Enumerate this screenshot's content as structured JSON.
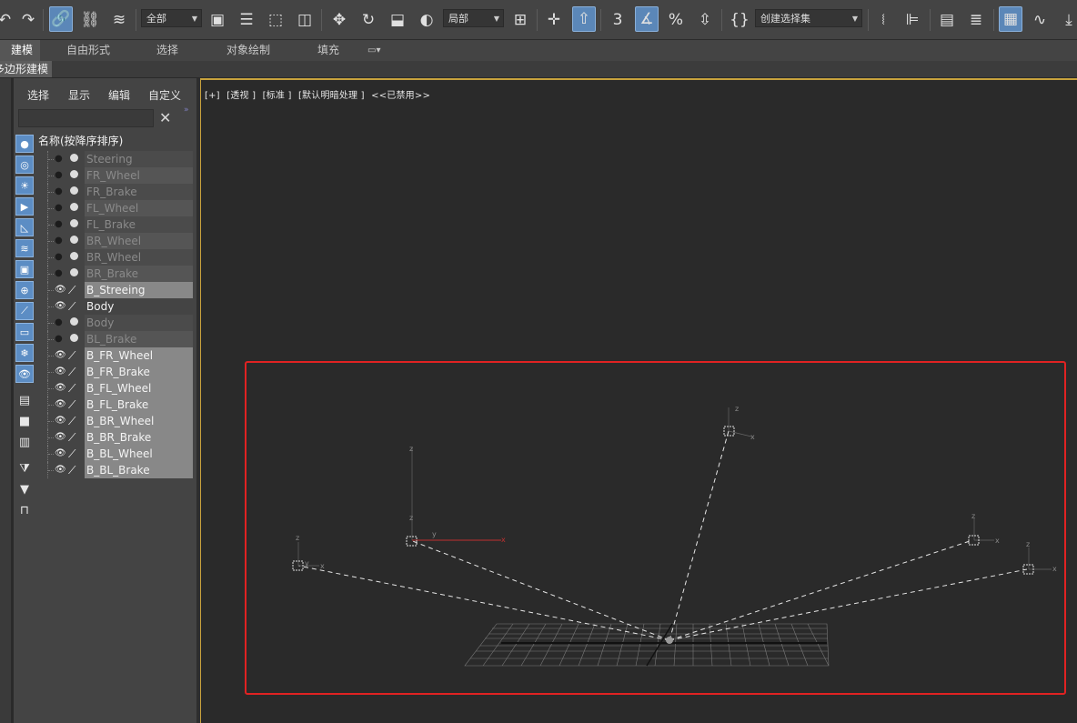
{
  "toolbar": {
    "selection_filter": "全部",
    "coord_system": "局部",
    "named_selection": "创建选择集"
  },
  "ribbon": {
    "tabs": [
      "建模",
      "自由形式",
      "选择",
      "对象绘制",
      "填充"
    ]
  },
  "subtab": {
    "label": "多边形建模"
  },
  "explorer": {
    "menu": [
      "选择",
      "显示",
      "编辑",
      "自定义"
    ],
    "search_placeholder": "",
    "column_header": "名称(按降序排序)",
    "rows": [
      {
        "name": "Steering",
        "state": "frozen"
      },
      {
        "name": "FR_Wheel",
        "state": "frozen"
      },
      {
        "name": "FR_Brake",
        "state": "frozen"
      },
      {
        "name": "FL_Wheel",
        "state": "frozen"
      },
      {
        "name": "FL_Brake",
        "state": "frozen"
      },
      {
        "name": "BR_Wheel",
        "state": "frozen"
      },
      {
        "name": "BR_Wheel",
        "state": "frozen"
      },
      {
        "name": "BR_Brake",
        "state": "frozen"
      },
      {
        "name": "B_Streeing",
        "state": "selected"
      },
      {
        "name": "Body",
        "state": "normal"
      },
      {
        "name": "Body",
        "state": "frozen"
      },
      {
        "name": "BL_Brake",
        "state": "frozen"
      },
      {
        "name": "B_FR_Wheel",
        "state": "selected"
      },
      {
        "name": "B_FR_Brake",
        "state": "selected"
      },
      {
        "name": "B_FL_Wheel",
        "state": "selected"
      },
      {
        "name": "B_FL_Brake",
        "state": "selected"
      },
      {
        "name": "B_BR_Wheel",
        "state": "selected"
      },
      {
        "name": "B_BR_Brake",
        "state": "selected"
      },
      {
        "name": "B_BL_Wheel",
        "state": "selected"
      },
      {
        "name": "B_BL_Brake",
        "state": "selected"
      }
    ]
  },
  "viewport": {
    "label_parts": [
      "[+]",
      "[透视 ]",
      "[标准 ]",
      "[默认明暗处理 ]",
      "<<已禁用>>"
    ],
    "axis_z": "z",
    "axis_x": "x",
    "axis_y": "y"
  },
  "colors": {
    "accent": "#5b87b8",
    "viewport_border": "#c8a23d",
    "highlight_box": "#e02222",
    "x_axis": "#c03030"
  }
}
